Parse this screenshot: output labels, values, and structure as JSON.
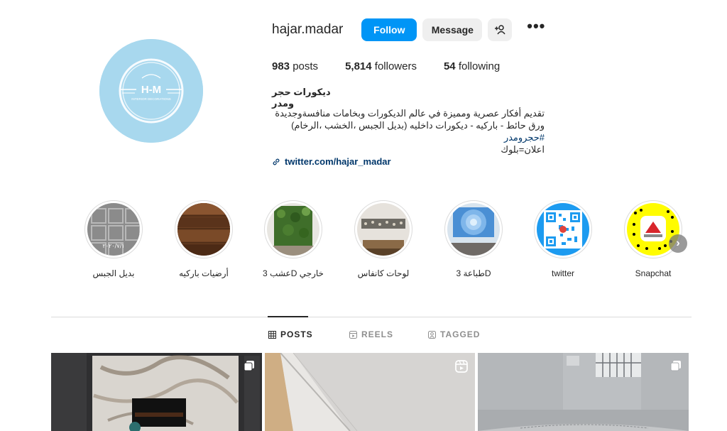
{
  "profile": {
    "username": "hajar.madar",
    "follow_label": "Follow",
    "message_label": "Message",
    "avatar_logo_text": "H-M",
    "avatar_logo_subtext": "INTERIOR DECORATIONS"
  },
  "stats": {
    "posts_count": "983",
    "posts_label": "posts",
    "followers_count": "5,814",
    "followers_label": "followers",
    "following_count": "54",
    "following_label": "following"
  },
  "bio": {
    "name": "ديكورات حجر ومدر",
    "line1": "تقديم أفكار عصرية ومميزة في عالم الديكورات وبخامات منافسةوجديدة",
    "line2": "ورق حائط - باركيه - ديكورات داخليه (بديل الجبس ،الخشب ،الرخام)",
    "hashtag": "#حجرومدر",
    "line4": "اعلان=بلوك",
    "link": "twitter.com/hajar_madar"
  },
  "highlights": [
    {
      "label": "بديل الجبس",
      "image_text": "٢٠٢٠/٧/١"
    },
    {
      "label": "أرضيات باركيه"
    },
    {
      "label": "عشب 3D خارجي"
    },
    {
      "label": "لوحات كانفاس"
    },
    {
      "label": "طباعة 3D"
    },
    {
      "label": "twitter"
    },
    {
      "label": "Snapchat"
    }
  ],
  "tabs": [
    {
      "label": "POSTS",
      "icon": "grid-icon",
      "active": true
    },
    {
      "label": "REELS",
      "icon": "reels-icon",
      "active": false
    },
    {
      "label": "TAGGED",
      "icon": "tagged-icon",
      "active": false
    }
  ],
  "colors": {
    "follow_blue": "#0095f6",
    "link_blue": "#00376b",
    "avatar_bg": "#a8d8ee",
    "divider": "#dbdbdb"
  }
}
